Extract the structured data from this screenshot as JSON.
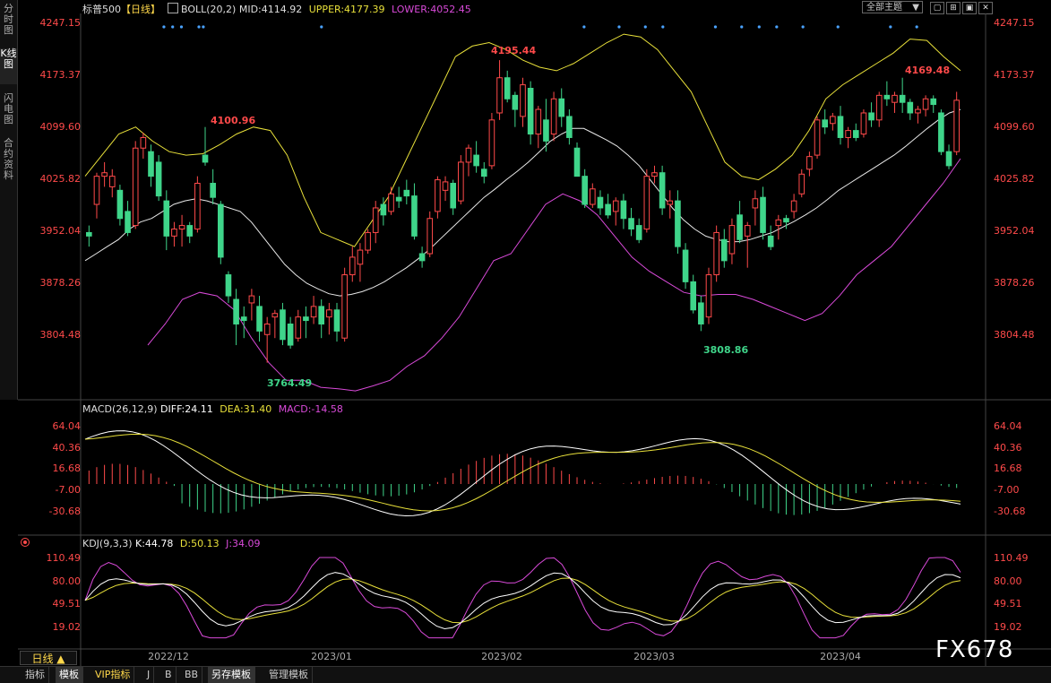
{
  "left_tabs": [
    {
      "label": "分时图",
      "active": false
    },
    {
      "label": "K线图",
      "active": true
    },
    {
      "label": "闪电图",
      "active": false
    },
    {
      "label": "合约资料",
      "active": false
    }
  ],
  "header": {
    "symbol": "标普500",
    "period": "【日线】",
    "boll_label": "BOLL(20,2)",
    "mid": "MID:4114.92",
    "upper": "UPPER:4177.39",
    "lower": "LOWER:4052.45",
    "theme_select": "全部主题",
    "theme_arrow": "▼"
  },
  "price_axis": [
    "4247.15",
    "4173.37",
    "4099.60",
    "4025.82",
    "3952.04",
    "3878.26",
    "3804.48"
  ],
  "price_range": [
    3720,
    4255
  ],
  "annotations": {
    "high1": "4100.96",
    "high2": "4195.44",
    "high3": "4169.48",
    "low1": "3764.49",
    "low2": "3808.86"
  },
  "macd": {
    "label": "MACD(26,12,9)",
    "diff": "DIFF:24.11",
    "dea": "DEA:31.40",
    "macd": "MACD:-14.58",
    "axis": [
      "64.04",
      "40.36",
      "16.68",
      "-7.00",
      "-30.68"
    ],
    "range": [
      -50,
      72
    ]
  },
  "kdj": {
    "label": "KDJ(9,3,3)",
    "k": "K:44.78",
    "d": "D:50.13",
    "j": "J:34.09",
    "axis": [
      "110.49",
      "80.00",
      "49.51",
      "19.02"
    ],
    "range": [
      -5,
      118
    ]
  },
  "dates": [
    "2022/12",
    "2023/01",
    "2023/02",
    "2023/03",
    "2023/04"
  ],
  "period_button": "日线 ▲",
  "bottom_tabs": [
    "指标",
    "模板",
    "VIP指标",
    "J",
    "B",
    "BB",
    "另存模板",
    "管理模板"
  ],
  "watermark": "FX678",
  "colors": {
    "up": "#ff4a4a",
    "down": "#3fd58a",
    "mid": "#e8e8e8",
    "upper": "#e8e03a",
    "lower": "#d94ad9",
    "axis_red": "#ff4a4a",
    "diff": "#ffffff",
    "dea": "#e8e03a",
    "macd": "#d94ad9"
  },
  "chart_data": {
    "type": "candlestick",
    "title": "标普500 【日线】",
    "ohlc": [
      [
        3950,
        3960,
        3930,
        3945
      ],
      [
        3990,
        4035,
        3970,
        4030
      ],
      [
        4030,
        4050,
        4015,
        4035
      ],
      [
        4015,
        4040,
        4000,
        4030
      ],
      [
        4010,
        4018,
        3960,
        3970
      ],
      [
        3980,
        3995,
        3945,
        3950
      ],
      [
        3960,
        4080,
        3955,
        4070
      ],
      [
        4070,
        4092,
        4055,
        4085
      ],
      [
        4065,
        4075,
        4015,
        4030
      ],
      [
        4050,
        4060,
        3995,
        4002
      ],
      [
        3995,
        4010,
        3925,
        3945
      ],
      [
        3945,
        3965,
        3930,
        3955
      ],
      [
        3955,
        3975,
        3930,
        3960
      ],
      [
        3960,
        3965,
        3935,
        3945
      ],
      [
        3955,
        4030,
        3950,
        4020
      ],
      [
        4060,
        4100,
        4045,
        4050
      ],
      [
        4020,
        4040,
        3990,
        4000
      ],
      [
        3990,
        3995,
        3905,
        3915
      ],
      [
        3890,
        3895,
        3850,
        3860
      ],
      [
        3855,
        3870,
        3790,
        3820
      ],
      [
        3830,
        3845,
        3800,
        3825
      ],
      [
        3850,
        3870,
        3825,
        3860
      ],
      [
        3845,
        3860,
        3795,
        3810
      ],
      [
        3805,
        3830,
        3765,
        3820
      ],
      [
        3830,
        3840,
        3800,
        3835
      ],
      [
        3840,
        3850,
        3790,
        3798
      ],
      [
        3820,
        3830,
        3785,
        3790
      ],
      [
        3800,
        3840,
        3795,
        3830
      ],
      [
        3830,
        3845,
        3800,
        3825
      ],
      [
        3830,
        3860,
        3820,
        3845
      ],
      [
        3845,
        3855,
        3800,
        3820
      ],
      [
        3830,
        3850,
        3805,
        3840
      ],
      [
        3840,
        3850,
        3795,
        3810
      ],
      [
        3800,
        3900,
        3795,
        3890
      ],
      [
        3890,
        3930,
        3880,
        3915
      ],
      [
        3905,
        3935,
        3880,
        3925
      ],
      [
        3925,
        3955,
        3920,
        3950
      ],
      [
        3950,
        3995,
        3935,
        3985
      ],
      [
        3990,
        4000,
        3960,
        3975
      ],
      [
        3980,
        4015,
        3975,
        4005
      ],
      [
        4000,
        4015,
        3985,
        3995
      ],
      [
        4010,
        4025,
        3990,
        4002
      ],
      [
        4002,
        4020,
        3940,
        3945
      ],
      [
        3920,
        3930,
        3900,
        3910
      ],
      [
        3920,
        3980,
        3915,
        3970
      ],
      [
        3980,
        4030,
        3970,
        4025
      ],
      [
        4010,
        4030,
        3995,
        4022
      ],
      [
        4020,
        4025,
        3975,
        3985
      ],
      [
        3995,
        4060,
        3990,
        4050
      ],
      [
        4050,
        4075,
        4030,
        4070
      ],
      [
        4060,
        4080,
        4035,
        4045
      ],
      [
        4040,
        4050,
        4020,
        4030
      ],
      [
        4045,
        4120,
        4040,
        4110
      ],
      [
        4120,
        4195,
        4110,
        4170
      ],
      [
        4170,
        4180,
        4135,
        4140
      ],
      [
        4145,
        4150,
        4100,
        4125
      ],
      [
        4115,
        4170,
        4100,
        4160
      ],
      [
        4155,
        4165,
        4075,
        4090
      ],
      [
        4090,
        4130,
        4070,
        4125
      ],
      [
        4110,
        4140,
        4065,
        4080
      ],
      [
        4090,
        4150,
        4080,
        4140
      ],
      [
        4140,
        4155,
        4100,
        4115
      ],
      [
        4115,
        4125,
        4075,
        4085
      ],
      [
        4070,
        4078,
        4040,
        4030
      ],
      [
        4030,
        4040,
        3985,
        3990
      ],
      [
        3990,
        4020,
        3985,
        4012
      ],
      [
        4000,
        4010,
        3975,
        3985
      ],
      [
        3990,
        4005,
        3970,
        3975
      ],
      [
        3980,
        4000,
        3960,
        3995
      ],
      [
        3995,
        4005,
        3955,
        3970
      ],
      [
        3970,
        3985,
        3945,
        3955
      ],
      [
        3960,
        3970,
        3935,
        3940
      ],
      [
        3955,
        4040,
        3950,
        4030
      ],
      [
        4030,
        4045,
        4020,
        4035
      ],
      [
        4035,
        4045,
        3975,
        3985
      ],
      [
        3990,
        4010,
        3970,
        3995
      ],
      [
        3995,
        4010,
        3920,
        3930
      ],
      [
        3925,
        3935,
        3870,
        3880
      ],
      [
        3880,
        3890,
        3835,
        3840
      ],
      [
        3850,
        3860,
        3810,
        3820
      ],
      [
        3830,
        3900,
        3820,
        3890
      ],
      [
        3890,
        3960,
        3880,
        3950
      ],
      [
        3940,
        3955,
        3900,
        3910
      ],
      [
        3920,
        3970,
        3905,
        3960
      ],
      [
        3975,
        3995,
        3935,
        3940
      ],
      [
        3945,
        3965,
        3900,
        3960
      ],
      [
        3985,
        4010,
        3960,
        3998
      ],
      [
        4000,
        4015,
        3940,
        3950
      ],
      [
        3945,
        3960,
        3925,
        3930
      ],
      [
        3960,
        3975,
        3940,
        3968
      ],
      [
        3970,
        3975,
        3955,
        3965
      ],
      [
        3980,
        4005,
        3970,
        3995
      ],
      [
        4005,
        4040,
        4000,
        4033
      ],
      [
        4040,
        4065,
        4030,
        4058
      ],
      [
        4060,
        4115,
        4055,
        4110
      ],
      [
        4110,
        4125,
        4090,
        4100
      ],
      [
        4105,
        4120,
        4095,
        4115
      ],
      [
        4115,
        4130,
        4075,
        4085
      ],
      [
        4085,
        4100,
        4070,
        4095
      ],
      [
        4095,
        4105,
        4080,
        4085
      ],
      [
        4090,
        4125,
        4085,
        4120
      ],
      [
        4120,
        4135,
        4100,
        4110
      ],
      [
        4110,
        4150,
        4100,
        4145
      ],
      [
        4145,
        4165,
        4130,
        4140
      ],
      [
        4135,
        4150,
        4120,
        4145
      ],
      [
        4145,
        4170,
        4120,
        4135
      ],
      [
        4135,
        4140,
        4110,
        4120
      ],
      [
        4120,
        4130,
        4105,
        4125
      ],
      [
        4125,
        4145,
        4115,
        4140
      ],
      [
        4140,
        4145,
        4120,
        4132
      ],
      [
        4120,
        4125,
        4060,
        4065
      ],
      [
        4065,
        4075,
        4040,
        4045
      ],
      [
        4065,
        4150,
        4060,
        4138
      ]
    ],
    "boll_mid": [
      3910,
      3920,
      3930,
      3940,
      3955,
      3965,
      3970,
      3980,
      3990,
      3995,
      3998,
      3995,
      3990,
      3985,
      3980,
      3965,
      3945,
      3925,
      3905,
      3890,
      3878,
      3870,
      3863,
      3860,
      3862,
      3866,
      3872,
      3880,
      3890,
      3900,
      3912,
      3925,
      3940,
      3955,
      3970,
      3985,
      4000,
      4012,
      4025,
      4037,
      4050,
      4065,
      4080,
      4090,
      4098,
      4098,
      4090,
      4082,
      4073,
      4060,
      4045,
      4025,
      4005,
      3985,
      3968,
      3955,
      3945,
      3940,
      3937,
      3937,
      3940,
      3945,
      3950,
      3958,
      3966,
      3975,
      3985,
      3997,
      4010,
      4020,
      4030,
      4040,
      4050,
      4060,
      4072,
      4085,
      4098,
      4110,
      4120,
      4125
    ],
    "boll_upper": [
      4030,
      4060,
      4090,
      4100,
      4080,
      4065,
      4060,
      4062,
      4075,
      4090,
      4100,
      4095,
      4060,
      4000,
      3950,
      3940,
      3930,
      3965,
      4000,
      4050,
      4100,
      4150,
      4200,
      4215,
      4220,
      4210,
      4195,
      4185,
      4180,
      4190,
      4205,
      4220,
      4232,
      4228,
      4210,
      4180,
      4150,
      4100,
      4050,
      4030,
      4025,
      4040,
      4060,
      4095,
      4140,
      4160,
      4175,
      4190,
      4205,
      4225,
      4223,
      4200,
      4180
    ],
    "boll_lower": [
      3790,
      3820,
      3855,
      3865,
      3860,
      3840,
      3800,
      3765,
      3740,
      3740,
      3730,
      3728,
      3725,
      3732,
      3740,
      3760,
      3775,
      3800,
      3830,
      3870,
      3910,
      3920,
      3955,
      3990,
      4005,
      3995,
      3975,
      3945,
      3915,
      3895,
      3880,
      3865,
      3860,
      3862,
      3862,
      3855,
      3845,
      3835,
      3825,
      3835,
      3860,
      3890,
      3910,
      3930,
      3960,
      3990,
      4020,
      4055
    ]
  }
}
